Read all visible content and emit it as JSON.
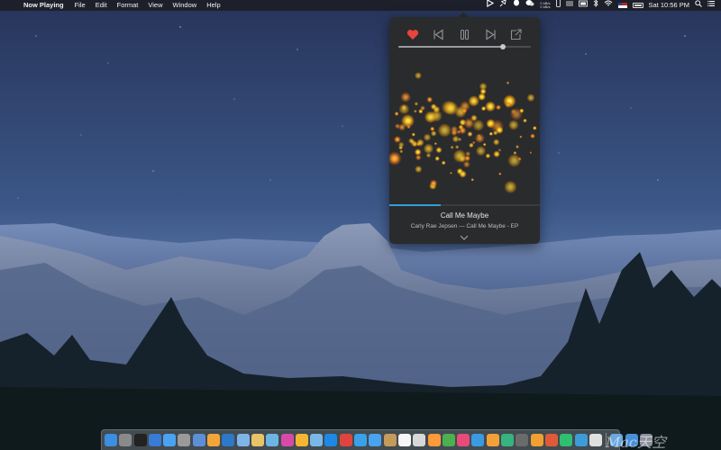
{
  "menubar": {
    "apple_glyph": "",
    "app_name": "Now Playing",
    "menus": [
      "File",
      "Edit",
      "Format",
      "View",
      "Window",
      "Help"
    ],
    "status": {
      "net_up": "0 kB/s",
      "net_down": "0 kB/s",
      "clock": "Sat 10:56 PM"
    }
  },
  "player": {
    "controls": [
      {
        "name": "love-button",
        "icon": "heart-icon",
        "color": "#e8453c"
      },
      {
        "name": "previous-button",
        "icon": "skip-back-icon"
      },
      {
        "name": "pause-button",
        "icon": "pause-icon"
      },
      {
        "name": "next-button",
        "icon": "skip-forward-icon"
      },
      {
        "name": "share-button",
        "icon": "share-icon"
      }
    ],
    "volume_fraction": 0.79,
    "playback_fraction": 0.34,
    "accent_color": "#2fa0d8",
    "track_title": "Call Me Maybe",
    "track_subtitle": "Carly Rae Jepsen — Call Me Maybe - EP",
    "expand_glyph": "⌄"
  },
  "dock": {
    "app_colors": [
      "#3b8ee0",
      "#8a8a8a",
      "#222222",
      "#3a7bd5",
      "#4aa3f0",
      "#9a9a9a",
      "#5d8fd8",
      "#f4a53a",
      "#2c79c8",
      "#7fb4e8",
      "#e8c468",
      "#6cb4e6",
      "#d84aa8",
      "#f2b632",
      "#7ab8e8",
      "#1e88e5",
      "#e0443e",
      "#3aa0e8",
      "#4aa3f0",
      "#c69a5a",
      "#f5f5f5",
      "#d8d8d8",
      "#ff9a3a",
      "#4caf50",
      "#e84a7a",
      "#3a9be0",
      "#f2a03a",
      "#36b37e",
      "#6b6b6b",
      "#f0a030",
      "#e05a3a",
      "#2fbf71",
      "#3d9bd8",
      "#e0e0e0"
    ],
    "folder_colors": [
      "#6aa8e0",
      "#4a90d9",
      "#8a8f99"
    ]
  },
  "watermark": "Mac天空"
}
